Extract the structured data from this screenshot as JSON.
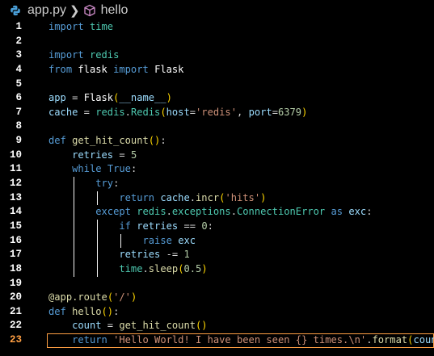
{
  "breadcrumb": {
    "file": "app.py",
    "symbol": "hello",
    "file_icon": "python-icon",
    "symbol_icon": "cube-icon"
  },
  "editor": {
    "active_line": 23,
    "lines": [
      {
        "n": "1",
        "tokens": [
          [
            "k",
            "import"
          ],
          [
            "p",
            " "
          ],
          [
            "m",
            "time"
          ]
        ]
      },
      {
        "n": "2",
        "tokens": []
      },
      {
        "n": "3",
        "tokens": [
          [
            "k",
            "import"
          ],
          [
            "p",
            " "
          ],
          [
            "m",
            "redis"
          ]
        ]
      },
      {
        "n": "4",
        "tokens": [
          [
            "k",
            "from"
          ],
          [
            "p",
            " "
          ],
          [
            "w",
            "flask"
          ],
          [
            "p",
            " "
          ],
          [
            "k",
            "import"
          ],
          [
            "p",
            " "
          ],
          [
            "w",
            "Flask"
          ]
        ]
      },
      {
        "n": "5",
        "tokens": []
      },
      {
        "n": "6",
        "tokens": [
          [
            "v",
            "app"
          ],
          [
            "p",
            " = "
          ],
          [
            "w",
            "Flask"
          ],
          [
            "y",
            "("
          ],
          [
            "v",
            "__name__"
          ],
          [
            "y",
            ")"
          ]
        ]
      },
      {
        "n": "7",
        "tokens": [
          [
            "v",
            "cache"
          ],
          [
            "p",
            " = "
          ],
          [
            "m",
            "redis"
          ],
          [
            "p",
            "."
          ],
          [
            "c",
            "Redis"
          ],
          [
            "y",
            "("
          ],
          [
            "v",
            "host"
          ],
          [
            "p",
            "="
          ],
          [
            "s",
            "'redis'"
          ],
          [
            "p",
            ", "
          ],
          [
            "v",
            "port"
          ],
          [
            "p",
            "="
          ],
          [
            "n",
            "6379"
          ],
          [
            "y",
            ")"
          ]
        ]
      },
      {
        "n": "8",
        "tokens": []
      },
      {
        "n": "9",
        "tokens": [
          [
            "k",
            "def"
          ],
          [
            "p",
            " "
          ],
          [
            "f",
            "get_hit_count"
          ],
          [
            "y",
            "()"
          ],
          [
            "p",
            ":"
          ]
        ]
      },
      {
        "n": "10",
        "tokens": [
          [
            "p",
            "    "
          ],
          [
            "v",
            "retries"
          ],
          [
            "p",
            " = "
          ],
          [
            "n",
            "5"
          ]
        ]
      },
      {
        "n": "11",
        "tokens": [
          [
            "p",
            "    "
          ],
          [
            "k",
            "while"
          ],
          [
            "p",
            " "
          ],
          [
            "k",
            "True"
          ],
          [
            "p",
            ":"
          ]
        ]
      },
      {
        "n": "12",
        "tokens": [
          [
            "p",
            "        "
          ],
          [
            "k",
            "try"
          ],
          [
            "p",
            ":"
          ]
        ]
      },
      {
        "n": "13",
        "tokens": [
          [
            "p",
            "            "
          ],
          [
            "k",
            "return"
          ],
          [
            "p",
            " "
          ],
          [
            "v",
            "cache"
          ],
          [
            "p",
            "."
          ],
          [
            "f",
            "incr"
          ],
          [
            "y",
            "("
          ],
          [
            "s",
            "'hits'"
          ],
          [
            "y",
            ")"
          ]
        ]
      },
      {
        "n": "14",
        "tokens": [
          [
            "p",
            "        "
          ],
          [
            "k",
            "except"
          ],
          [
            "p",
            " "
          ],
          [
            "m",
            "redis"
          ],
          [
            "p",
            "."
          ],
          [
            "m",
            "exceptions"
          ],
          [
            "p",
            "."
          ],
          [
            "c",
            "ConnectionError"
          ],
          [
            "p",
            " "
          ],
          [
            "k",
            "as"
          ],
          [
            "p",
            " "
          ],
          [
            "v",
            "exc"
          ],
          [
            "p",
            ":"
          ]
        ]
      },
      {
        "n": "15",
        "tokens": [
          [
            "p",
            "            "
          ],
          [
            "k",
            "if"
          ],
          [
            "p",
            " "
          ],
          [
            "v",
            "retries"
          ],
          [
            "p",
            " == "
          ],
          [
            "n",
            "0"
          ],
          [
            "p",
            ":"
          ]
        ]
      },
      {
        "n": "16",
        "tokens": [
          [
            "p",
            "                "
          ],
          [
            "k",
            "raise"
          ],
          [
            "p",
            " "
          ],
          [
            "v",
            "exc"
          ]
        ]
      },
      {
        "n": "17",
        "tokens": [
          [
            "p",
            "            "
          ],
          [
            "v",
            "retries"
          ],
          [
            "p",
            " -= "
          ],
          [
            "n",
            "1"
          ]
        ]
      },
      {
        "n": "18",
        "tokens": [
          [
            "p",
            "            "
          ],
          [
            "m",
            "time"
          ],
          [
            "p",
            "."
          ],
          [
            "f",
            "sleep"
          ],
          [
            "y",
            "("
          ],
          [
            "n",
            "0.5"
          ],
          [
            "y",
            ")"
          ]
        ]
      },
      {
        "n": "19",
        "tokens": []
      },
      {
        "n": "20",
        "tokens": [
          [
            "f",
            "@app.route"
          ],
          [
            "y",
            "("
          ],
          [
            "s",
            "'/'"
          ],
          [
            "y",
            ")"
          ]
        ]
      },
      {
        "n": "21",
        "tokens": [
          [
            "k",
            "def"
          ],
          [
            "p",
            " "
          ],
          [
            "f",
            "hello"
          ],
          [
            "y",
            "()"
          ],
          [
            "p",
            ":"
          ]
        ]
      },
      {
        "n": "22",
        "tokens": [
          [
            "p",
            "    "
          ],
          [
            "v",
            "count"
          ],
          [
            "p",
            " = "
          ],
          [
            "f",
            "get_hit_count"
          ],
          [
            "y",
            "()"
          ]
        ]
      },
      {
        "n": "23",
        "tokens": [
          [
            "p",
            "    "
          ],
          [
            "k",
            "return"
          ],
          [
            "p",
            " "
          ],
          [
            "s",
            "'Hello World! I have been seen {} times.\\n'"
          ],
          [
            "p",
            "."
          ],
          [
            "f",
            "format"
          ],
          [
            "y",
            "("
          ],
          [
            "v",
            "count"
          ],
          [
            "y",
            ")"
          ]
        ]
      }
    ]
  }
}
